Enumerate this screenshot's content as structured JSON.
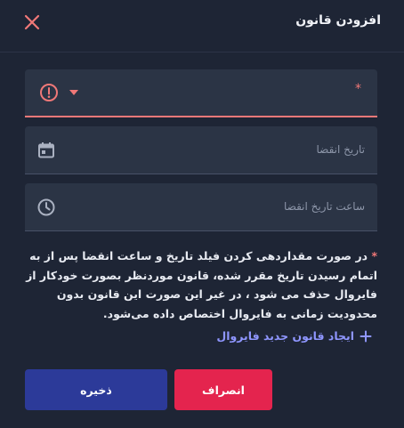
{
  "dialog": {
    "title": "افزودن قانون"
  },
  "fields": {
    "rule_select": {
      "required_mark": "*",
      "value": ""
    },
    "expiry_date": {
      "placeholder": "تاریخ انقضا"
    },
    "expiry_time": {
      "placeholder": "ساعت تاریخ انقضا"
    }
  },
  "note": {
    "star": "*",
    "text": "در صورت مقداردهی کردن فیلد تاریخ و ساعت انقضا پس از به اتمام رسیدن تاریخ مقرر شده، قانون موردنظر بصورت خودکار از فایروال حذف می شود ، در غیر این صورت این قانون بدون محدودیت زمانی به فایروال اختصاص داده می‌شود."
  },
  "actions": {
    "add_rule_label": "ایجاد قانون جدید فایروال",
    "cancel_label": "انصراف",
    "save_label": "ذخیره"
  },
  "colors": {
    "background": "#1e2535",
    "field": "#2b3445",
    "error": "#f07878",
    "link": "#8f96ff",
    "cancel": "#e4244e",
    "save": "#2c3a99"
  },
  "icons": [
    "close-icon",
    "error-icon",
    "chevron-down-icon",
    "calendar-icon",
    "clock-icon",
    "plus-icon"
  ]
}
